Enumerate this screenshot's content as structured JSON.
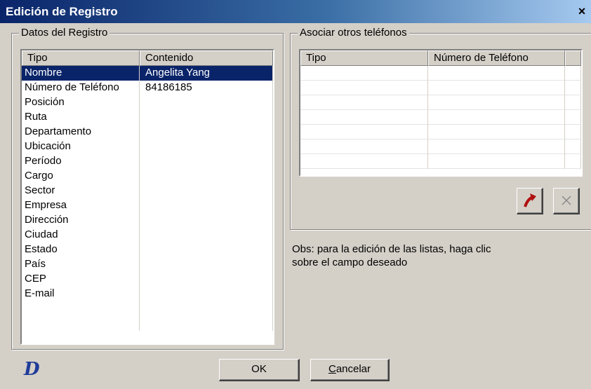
{
  "window": {
    "title": "Edición de Registro",
    "close_glyph": "✕"
  },
  "left_group": {
    "label": "Datos del Registro",
    "columns": [
      "Tipo",
      "Contenido"
    ],
    "rows": [
      {
        "tipo": "Nombre",
        "contenido": "Angelita Yang",
        "selected": true
      },
      {
        "tipo": "Número de Teléfono",
        "contenido": "84186185"
      },
      {
        "tipo": "Posición",
        "contenido": ""
      },
      {
        "tipo": "Ruta",
        "contenido": ""
      },
      {
        "tipo": "Departamento",
        "contenido": ""
      },
      {
        "tipo": "Ubicación",
        "contenido": ""
      },
      {
        "tipo": "Período",
        "contenido": ""
      },
      {
        "tipo": "Cargo",
        "contenido": ""
      },
      {
        "tipo": "Sector",
        "contenido": ""
      },
      {
        "tipo": "Empresa",
        "contenido": ""
      },
      {
        "tipo": "Dirección",
        "contenido": ""
      },
      {
        "tipo": "Ciudad",
        "contenido": ""
      },
      {
        "tipo": "Estado",
        "contenido": ""
      },
      {
        "tipo": "País",
        "contenido": ""
      },
      {
        "tipo": "CEP",
        "contenido": ""
      },
      {
        "tipo": "E-mail",
        "contenido": ""
      },
      {
        "tipo": "",
        "contenido": ""
      },
      {
        "tipo": "",
        "contenido": ""
      }
    ]
  },
  "right_group": {
    "label": "Asociar otros teléfonos",
    "columns": [
      "Tipo",
      "Número de Teléfono"
    ],
    "empty_rows": 7,
    "add_icon": "arrow-up-right-icon",
    "delete_icon": "x-icon"
  },
  "note": {
    "line1": "Obs: para la edición de las listas, haga clic",
    "line2": "sobre el campo deseado"
  },
  "buttons": {
    "ok": "OK",
    "cancel_first": "C",
    "cancel_rest": "ancelar"
  },
  "colors": {
    "selection": "#0a246a",
    "title_start": "#0a246a",
    "logo": "#1f3c9a",
    "add_arrow": "#b01010"
  }
}
